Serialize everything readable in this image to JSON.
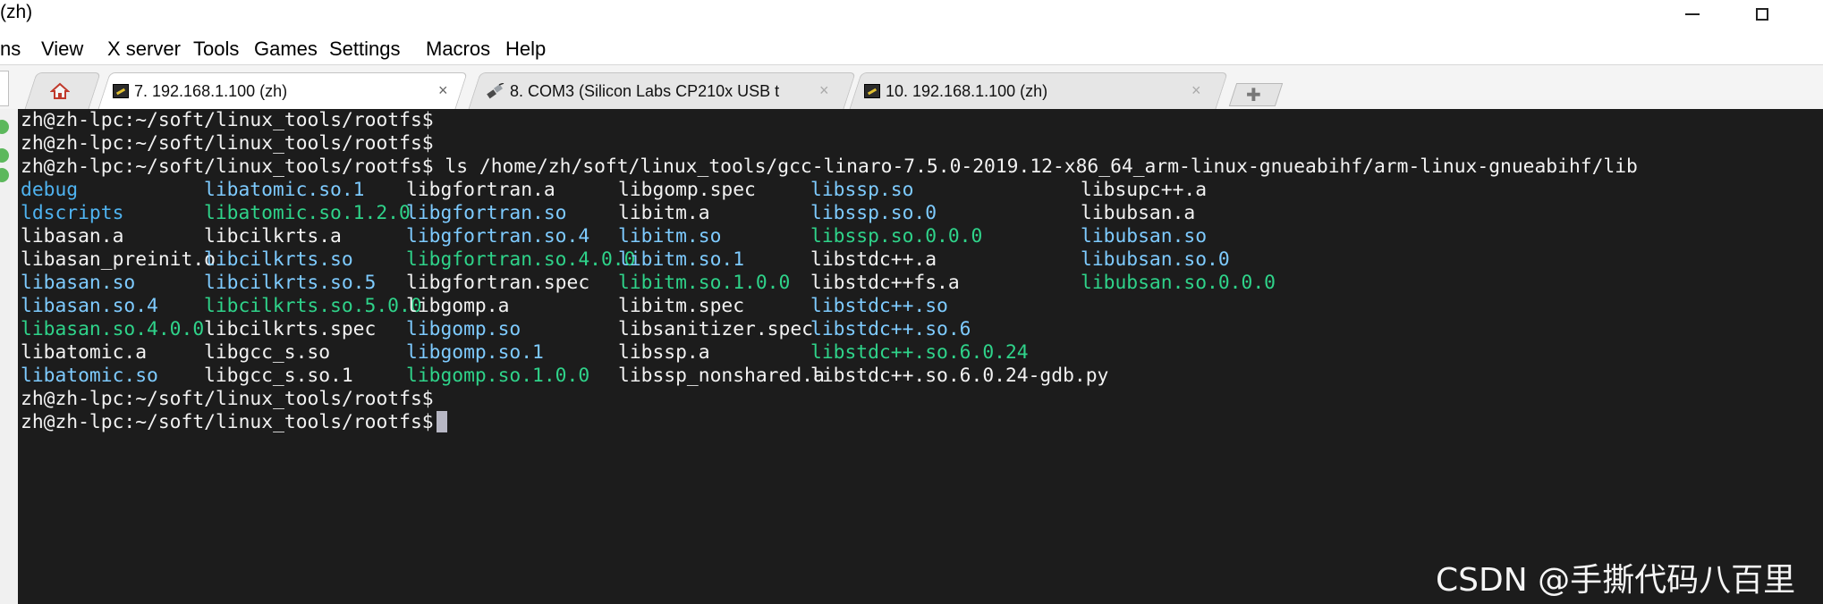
{
  "window": {
    "title": "(zh)"
  },
  "menu": {
    "items": [
      "ns",
      "View",
      "X server",
      "Tools",
      "Games",
      "Settings",
      "Macros",
      "Help"
    ]
  },
  "tabs": [
    {
      "label": "7. 192.168.1.100 (zh)",
      "icon": "terminal-pencil-icon",
      "active": true
    },
    {
      "label": "8. COM3  (Silicon Labs CP210x USB t",
      "icon": "serial-plug-icon",
      "active": false
    },
    {
      "label": "10. 192.168.1.100 (zh)",
      "icon": "terminal-pencil-icon",
      "active": false
    }
  ],
  "close_glyph": "×",
  "terminal": {
    "prompt": "zh@zh-lpc:~/soft/linux_tools/rootfs$",
    "command": " ls /home/zh/soft/linux_tools/gcc-linaro-7.5.0-2019.12-x86_64_arm-linux-gnueabihf/arm-linux-gnueabihf/lib",
    "listing_columns": [
      [
        {
          "name": "debug",
          "color": "blue"
        },
        {
          "name": "ldscripts",
          "color": "blue"
        },
        {
          "name": "libasan.a",
          "color": "white"
        },
        {
          "name": "libasan_preinit.o",
          "color": "white"
        },
        {
          "name": "libasan.so",
          "color": "cyan"
        },
        {
          "name": "libasan.so.4",
          "color": "cyan"
        },
        {
          "name": "libasan.so.4.0.0",
          "color": "green"
        },
        {
          "name": "libatomic.a",
          "color": "white"
        },
        {
          "name": "libatomic.so",
          "color": "cyan"
        }
      ],
      [
        {
          "name": "libatomic.so.1",
          "color": "cyan"
        },
        {
          "name": "libatomic.so.1.2.0",
          "color": "green"
        },
        {
          "name": "libcilkrts.a",
          "color": "white"
        },
        {
          "name": "libcilkrts.so",
          "color": "cyan"
        },
        {
          "name": "libcilkrts.so.5",
          "color": "cyan"
        },
        {
          "name": "libcilkrts.so.5.0.0",
          "color": "green"
        },
        {
          "name": "libcilkrts.spec",
          "color": "white"
        },
        {
          "name": "libgcc_s.so",
          "color": "white"
        },
        {
          "name": "libgcc_s.so.1",
          "color": "white"
        }
      ],
      [
        {
          "name": "libgfortran.a",
          "color": "white"
        },
        {
          "name": "libgfortran.so",
          "color": "cyan"
        },
        {
          "name": "libgfortran.so.4",
          "color": "cyan"
        },
        {
          "name": "libgfortran.so.4.0.0",
          "color": "green"
        },
        {
          "name": "libgfortran.spec",
          "color": "white"
        },
        {
          "name": "libgomp.a",
          "color": "white"
        },
        {
          "name": "libgomp.so",
          "color": "cyan"
        },
        {
          "name": "libgomp.so.1",
          "color": "cyan"
        },
        {
          "name": "libgomp.so.1.0.0",
          "color": "green"
        }
      ],
      [
        {
          "name": "libgomp.spec",
          "color": "white"
        },
        {
          "name": "libitm.a",
          "color": "white"
        },
        {
          "name": "libitm.so",
          "color": "cyan"
        },
        {
          "name": "libitm.so.1",
          "color": "cyan"
        },
        {
          "name": "libitm.so.1.0.0",
          "color": "green"
        },
        {
          "name": "libitm.spec",
          "color": "white"
        },
        {
          "name": "libsanitizer.spec",
          "color": "white"
        },
        {
          "name": "libssp.a",
          "color": "white"
        },
        {
          "name": "libssp_nonshared.a",
          "color": "white"
        }
      ],
      [
        {
          "name": "libssp.so",
          "color": "cyan"
        },
        {
          "name": "libssp.so.0",
          "color": "cyan"
        },
        {
          "name": "libssp.so.0.0.0",
          "color": "green"
        },
        {
          "name": "libstdc++.a",
          "color": "white"
        },
        {
          "name": "libstdc++fs.a",
          "color": "white"
        },
        {
          "name": "libstdc++.so",
          "color": "cyan"
        },
        {
          "name": "libstdc++.so.6",
          "color": "cyan"
        },
        {
          "name": "libstdc++.so.6.0.24",
          "color": "green"
        },
        {
          "name": "libstdc++.so.6.0.24-gdb.py",
          "color": "white"
        }
      ],
      [
        {
          "name": "libsupc++.a",
          "color": "white"
        },
        {
          "name": "libubsan.a",
          "color": "white"
        },
        {
          "name": "libubsan.so",
          "color": "cyan"
        },
        {
          "name": "libubsan.so.0",
          "color": "cyan"
        },
        {
          "name": "libubsan.so.0.0.0",
          "color": "green"
        }
      ]
    ]
  },
  "colors": {
    "terminal_bg": "#1c1c1c",
    "text": "#f2f2f2",
    "blue": "#4fb3f0",
    "cyan": "#7ecbff",
    "green": "#2fd38a"
  },
  "watermark": {
    "text": "CSDN @手撕代码八百里"
  }
}
